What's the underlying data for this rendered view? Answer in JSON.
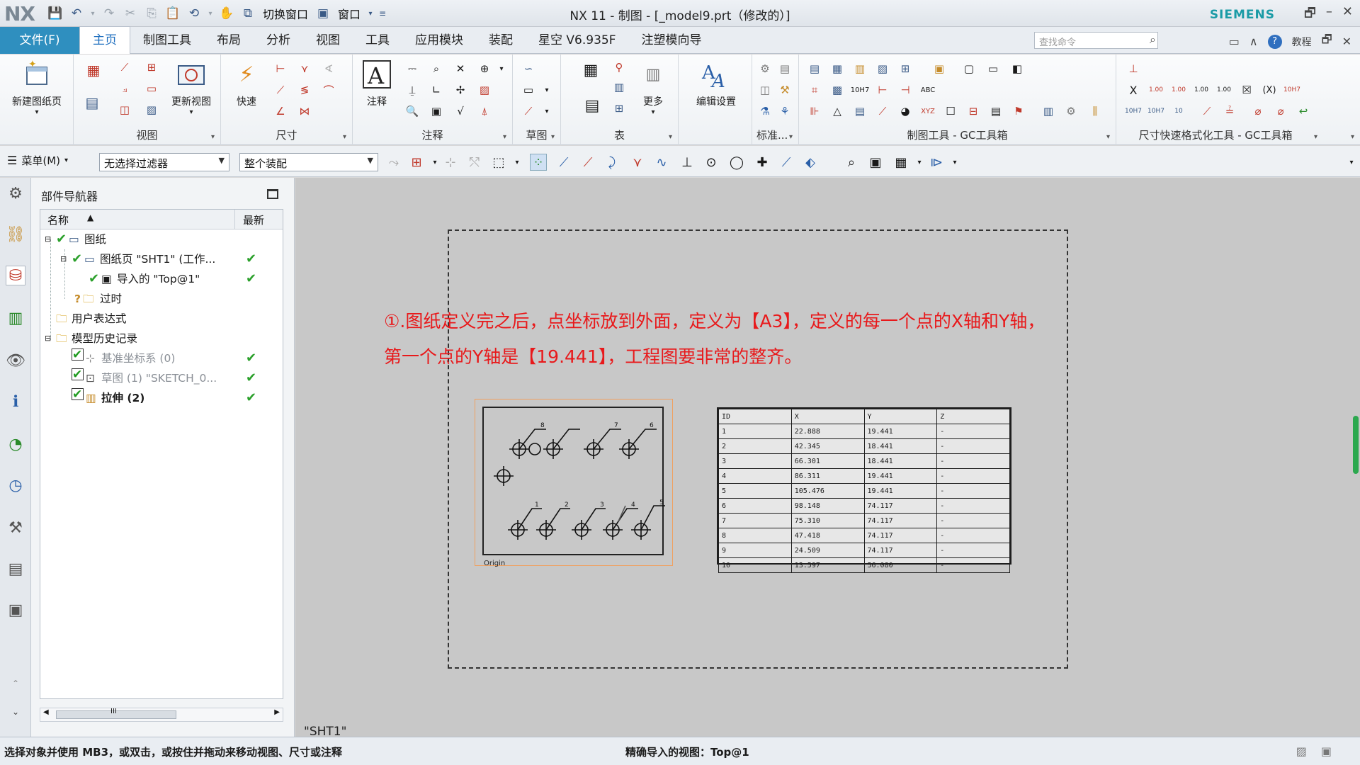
{
  "titlebar": {
    "logo": "NX",
    "switch_window": "切换窗口",
    "window_menu": "窗口",
    "title": "NX 11 - 制图 - [_model9.prt（修改的）]",
    "brand": "SIEMENS"
  },
  "menu_tabs": {
    "file": "文件(F)",
    "items": [
      "主页",
      "制图工具",
      "布局",
      "分析",
      "视图",
      "工具",
      "应用模块",
      "装配",
      "星空 V6.935F",
      "注塑模向导"
    ],
    "active": "主页",
    "search_placeholder": "查找命令",
    "tutorial": "教程"
  },
  "ribbon": {
    "new_sheet": "新建图纸页",
    "view_group": "视图",
    "update_views": "更新视图",
    "quick": "快速",
    "dimension_group": "尺寸",
    "note": "注释",
    "annotation_group": "注释",
    "sketch_group": "草图",
    "more": "更多",
    "table_group": "表",
    "edit_settings": "编辑设置",
    "standard_group": "标准...",
    "gc_toolbox_group": "制图工具 - GC工具箱",
    "dim_fast_group": "尺寸快速格式化工具 - GC工具箱",
    "dim_value_a": "1.00",
    "dim_value_b": "10H7"
  },
  "command_bar": {
    "menu": "菜单(M)",
    "filter": "无选择过滤器",
    "scope": "整个装配"
  },
  "navigator": {
    "title": "部件导航器",
    "col_name": "名称",
    "col_latest": "最新",
    "rows": [
      {
        "label": "图纸",
        "greyed": false
      },
      {
        "label": "图纸页 \"SHT1\" (工作...",
        "greyed": false
      },
      {
        "label": "导入的 \"Top@1\"",
        "greyed": false
      },
      {
        "label": "过时",
        "greyed": false
      },
      {
        "label": "用户表达式",
        "greyed": false
      },
      {
        "label": "模型历史记录",
        "greyed": false
      },
      {
        "label": "基准坐标系 (0)",
        "greyed": true
      },
      {
        "label": "草图 (1) \"SKETCH_0...",
        "greyed": true
      },
      {
        "label": "拉伸 (2)",
        "greyed": false
      }
    ],
    "scroll_grip": "III"
  },
  "canvas": {
    "instruction_line1": "①.图纸定义完之后，点坐标放到外面，定义为【A3】，定义的每一个点的X轴和Y轴，",
    "instruction_line2": "第一个点的Y轴是【19.441】，工程图要非常的整齐。",
    "view_label": "Origin",
    "sheet_name": "\"SHT1\""
  },
  "coord_table": {
    "headers": [
      "ID",
      "X",
      "Y",
      "Z"
    ],
    "rows": [
      [
        "1",
        "22.888",
        "19.441",
        "-"
      ],
      [
        "2",
        "42.345",
        "18.441",
        "-"
      ],
      [
        "3",
        "66.301",
        "18.441",
        "-"
      ],
      [
        "4",
        "86.311",
        "19.441",
        "-"
      ],
      [
        "5",
        "105.476",
        "19.441",
        "-"
      ],
      [
        "6",
        "98.148",
        "74.117",
        "-"
      ],
      [
        "7",
        "75.310",
        "74.117",
        "-"
      ],
      [
        "8",
        "47.418",
        "74.117",
        "-"
      ],
      [
        "9",
        "24.509",
        "74.117",
        "-"
      ],
      [
        "10",
        "13.597",
        "56.080",
        "-"
      ]
    ]
  },
  "drawing_view": {
    "hole_labels": [
      "8",
      "7",
      "6",
      "1",
      "2",
      "3",
      "4",
      "5"
    ]
  },
  "statusbar": {
    "left": "选择对象并使用 MB3，或双击，或按住并拖动来移动视图、尺寸或注释",
    "center": "精确导入的视图：Top@1"
  },
  "colors": {
    "accent_blue": "#2f8fbf",
    "instruction_red": "#e8191b",
    "check_green": "#2ba02b"
  }
}
